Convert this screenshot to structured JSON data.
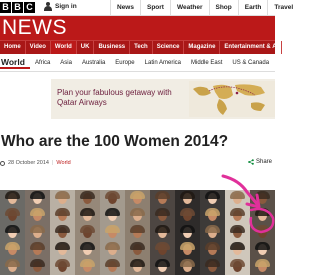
{
  "header": {
    "logo_letters": [
      "B",
      "B",
      "C"
    ],
    "signin": "Sign in",
    "nav": [
      "News",
      "Sport",
      "Weather",
      "Shop",
      "Earth",
      "Travel"
    ]
  },
  "news": {
    "wordmark": "NEWS",
    "sections": [
      "Home",
      "Video",
      "World",
      "UK",
      "Business",
      "Tech",
      "Science",
      "Magazine",
      "Entertainment & A"
    ],
    "active_section": "World",
    "subnav": [
      "World",
      "Africa",
      "Asia",
      "Australia",
      "Europe",
      "Latin America",
      "Middle East",
      "US & Canada"
    ]
  },
  "ad": {
    "text": "Plan your fabulous getaway with Qatar Airways"
  },
  "article": {
    "title": "Who are the 100 Women 2014?",
    "date": "28 October 2014",
    "topic": "World",
    "share": "Share"
  },
  "colors": {
    "bbc_red": "#bb1919",
    "annotation_pink": "#e0309a"
  }
}
